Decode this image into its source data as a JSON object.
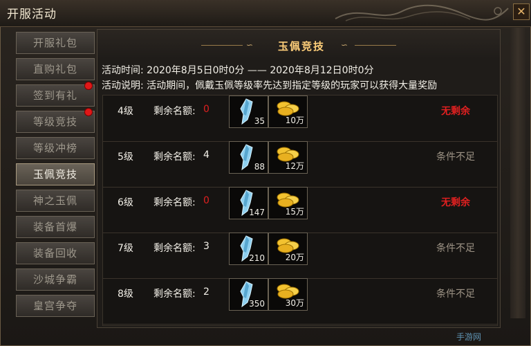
{
  "window": {
    "title": "开服活动",
    "close_label": "✕"
  },
  "sidebar": {
    "items": [
      {
        "label": "开服礼包",
        "active": false,
        "dot": false
      },
      {
        "label": "直购礼包",
        "active": false,
        "dot": false
      },
      {
        "label": "签到有礼",
        "active": false,
        "dot": true
      },
      {
        "label": "等级竞技",
        "active": false,
        "dot": true
      },
      {
        "label": "等级冲榜",
        "active": false,
        "dot": false
      },
      {
        "label": "玉佩竞技",
        "active": true,
        "dot": false
      },
      {
        "label": "神之玉佩",
        "active": false,
        "dot": false
      },
      {
        "label": "装备首爆",
        "active": false,
        "dot": false
      },
      {
        "label": "装备回收",
        "active": false,
        "dot": false
      },
      {
        "label": "沙城争霸",
        "active": false,
        "dot": false
      },
      {
        "label": "皇宫争夺",
        "active": false,
        "dot": false
      }
    ]
  },
  "main": {
    "banner_title": "玉佩竞技",
    "time_line": "活动时间: 2020年8月5日0时0分  ——  2020年8月12日0时0分",
    "desc_line": "活动说明: 活动期间，佩戴玉佩等级率先达到指定等级的玩家可以获得大量奖励",
    "remain_label": "剩余名额:",
    "rows": [
      {
        "level": "4级",
        "remain": "0",
        "crystal": "35",
        "gold": "10万",
        "status": "无剩余",
        "status_type": "none"
      },
      {
        "level": "5级",
        "remain": "4",
        "crystal": "88",
        "gold": "12万",
        "status": "条件不足",
        "status_type": "fail"
      },
      {
        "level": "6级",
        "remain": "0",
        "crystal": "147",
        "gold": "15万",
        "status": "无剩余",
        "status_type": "none"
      },
      {
        "level": "7级",
        "remain": "3",
        "crystal": "210",
        "gold": "20万",
        "status": "条件不足",
        "status_type": "fail"
      },
      {
        "level": "8级",
        "remain": "2",
        "crystal": "350",
        "gold": "30万",
        "status": "条件不足",
        "status_type": "fail"
      }
    ]
  },
  "colors": {
    "remain_zero": "#e02020",
    "remain_normal": "#f3f0e8"
  }
}
